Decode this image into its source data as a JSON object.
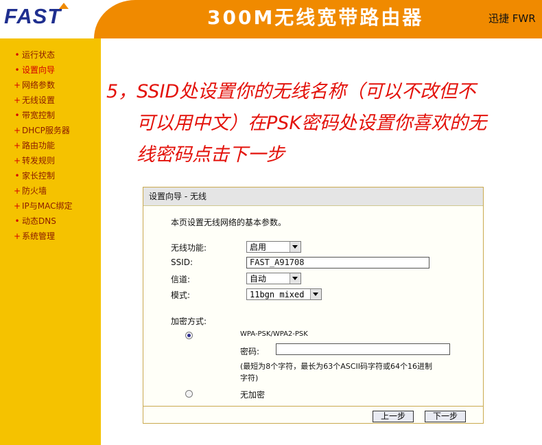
{
  "header": {
    "logo": "FAST",
    "product_title": "300M无线宽带路由器",
    "brand": "迅捷 FWR"
  },
  "sidebar": {
    "items": [
      {
        "label": "运行状态",
        "bullet": "•"
      },
      {
        "label": "设置向导",
        "bullet": "•"
      },
      {
        "label": "网络参数",
        "bullet": "+"
      },
      {
        "label": "无线设置",
        "bullet": "+"
      },
      {
        "label": "带宽控制",
        "bullet": "•"
      },
      {
        "label": "DHCP服务器",
        "bullet": "+"
      },
      {
        "label": "路由功能",
        "bullet": "+"
      },
      {
        "label": "转发规则",
        "bullet": "+"
      },
      {
        "label": "家长控制",
        "bullet": "•"
      },
      {
        "label": "防火墙",
        "bullet": "+"
      },
      {
        "label": "IP与MAC绑定",
        "bullet": "+"
      },
      {
        "label": "动态DNS",
        "bullet": "•"
      },
      {
        "label": "系统管理",
        "bullet": "+"
      }
    ]
  },
  "instruction": {
    "line1": "5，SSID处设置你的无线名称（可以不改但不",
    "line2": "可以用中文）在PSK密码处设置你喜欢的无",
    "line3": "线密码点击下一步"
  },
  "panel": {
    "title": "设置向导 - 无线",
    "description": "本页设置无线网络的基本参数。",
    "wireless_label": "无线功能:",
    "wireless_value": "启用",
    "ssid_label": "SSID:",
    "ssid_value": "FAST_A91708",
    "channel_label": "信道:",
    "channel_value": "自动",
    "mode_label": "模式:",
    "mode_value": "11bgn mixed",
    "encryption_label": "加密方式:",
    "wpa_label": "WPA-PSK/WPA2-PSK",
    "password_label": "密码:",
    "password_value": "",
    "hint_line1": "(最短为8个字符，最长为63个ASCII码字符或64个16进制",
    "hint_line2": "字符)",
    "no_encryption_label": "无加密",
    "prev_button": "上一步",
    "next_button": "下一步"
  },
  "colors": {
    "header_orange": "#f08a00",
    "sidebar_yellow": "#f5c200",
    "instruction_red": "#e3120b",
    "logo_blue": "#1f2f8f"
  }
}
